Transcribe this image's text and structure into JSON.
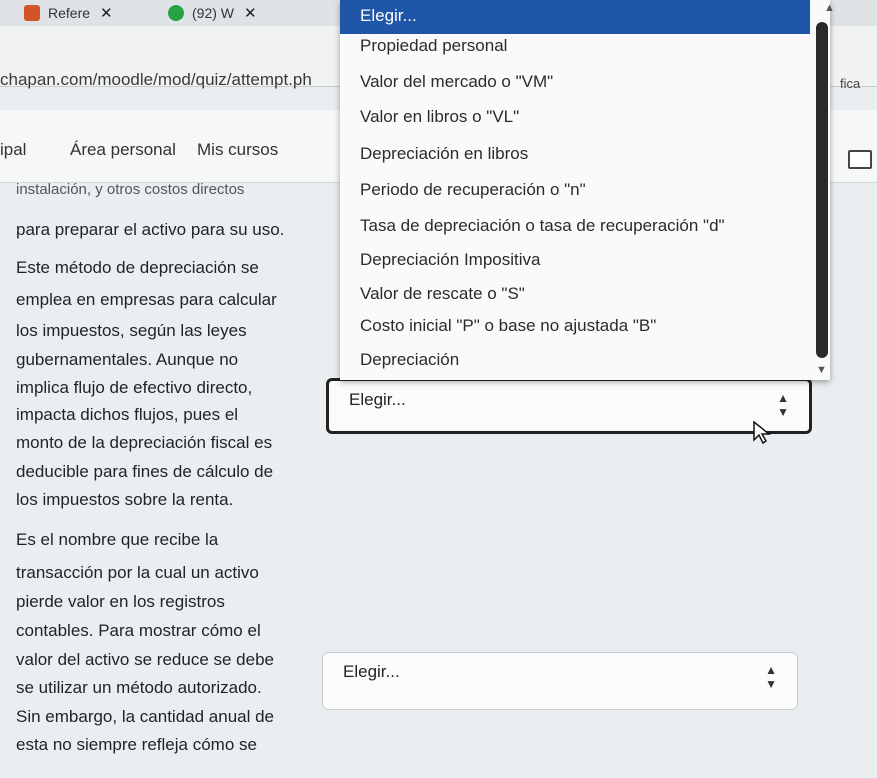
{
  "browser": {
    "tabs": [
      {
        "label": "Refere",
        "close": "✕"
      },
      {
        "label": "(92) W",
        "close": "✕"
      }
    ],
    "url": "chapan.com/moodle/mod/quiz/attempt.ph",
    "url_right": "fica"
  },
  "nav": {
    "items": [
      "ipal",
      "Área personal",
      "Mis cursos"
    ]
  },
  "question_1": {
    "lines": [
      "instalación, y otros costos directos",
      "para preparar el activo para su uso.",
      "Este método de depreciación se",
      "emplea en empresas para calcular",
      "los impuestos, según las leyes",
      "gubernamentales. Aunque no",
      "implica flujo de efectivo directo,",
      "impacta dichos flujos, pues el",
      "monto de la depreciación fiscal es",
      "deducible para fines de cálculo de",
      "los impuestos sobre la renta."
    ],
    "select_value": "Elegir..."
  },
  "question_2": {
    "lines": [
      "Es el nombre que recibe la",
      "transacción por la cual un activo",
      "pierde valor en los registros",
      "contables. Para mostrar cómo el",
      "valor del activo se reduce se debe",
      "se utilizar un método autorizado.",
      "Sin embargo, la cantidad anual de",
      "esta no siempre refleja cómo se"
    ],
    "select_value": "Elegir..."
  },
  "dropdown": {
    "selected": "Elegir...",
    "options": [
      "Elegir...",
      "Propiedad personal",
      "Valor del mercado o \"VM\"",
      "Valor en libros o \"VL\"",
      "Depreciación en libros",
      "Periodo de recuperación o \"n\"",
      "Tasa de depreciación o tasa de recuperación \"d\"",
      "Depreciación Impositiva",
      "Valor de rescate o \"S\"",
      "Costo inicial \"P\" o base no ajustada \"B\"",
      "Depreciación"
    ]
  },
  "colors": {
    "selected_option": "#1f56a8",
    "page_background": "#e9eef0"
  }
}
